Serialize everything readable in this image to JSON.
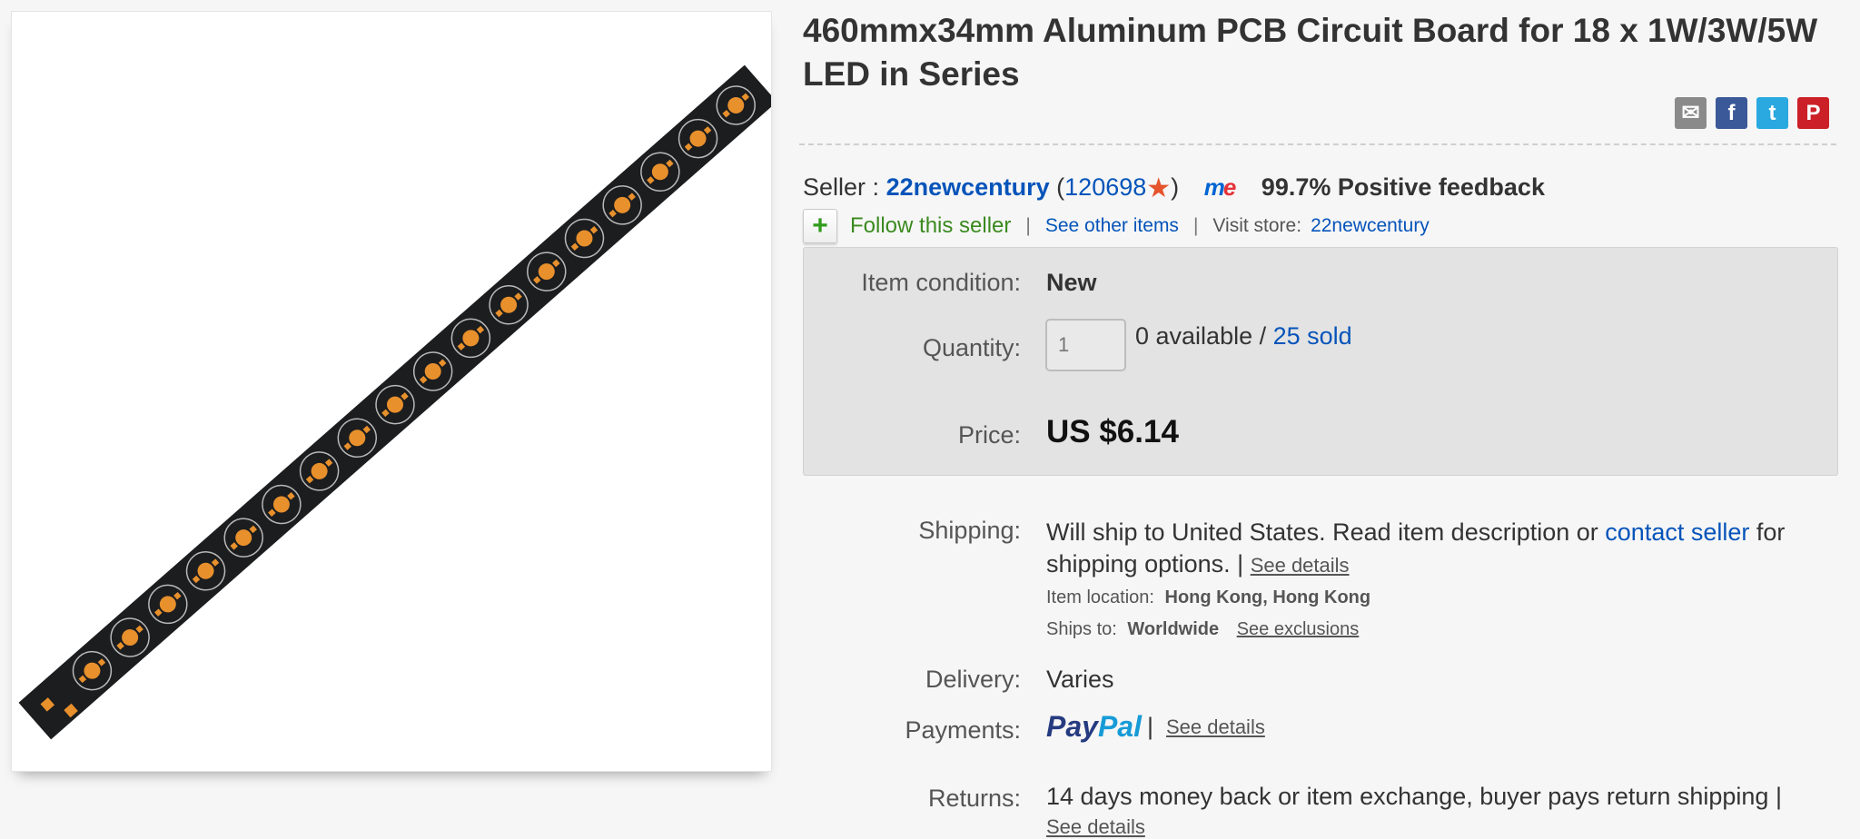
{
  "title": "460mmx34mm Aluminum PCB Circuit Board for 18 x 1W/3W/5W LED in Series",
  "share": {
    "email": "email-icon",
    "facebook": "facebook-icon",
    "twitter": "twitter-icon",
    "pinterest": "pinterest-icon"
  },
  "seller": {
    "label": "Seller :",
    "name": "22newcentury",
    "score": "120698",
    "feedback": "99.7% Positive feedback",
    "follow": "Follow this seller",
    "see_other": "See other items",
    "visit_store_label": "Visit store:",
    "store": "22newcentury"
  },
  "condition": {
    "label": "Item condition:",
    "value": "New",
    "quantity_label": "Quantity:",
    "quantity_value": "1",
    "available": "0 available /",
    "sold": "25 sold",
    "price_label": "Price:",
    "price": "US $6.14"
  },
  "shipping": {
    "label": "Shipping:",
    "text1": "Will ship to United States. Read item description or",
    "contact": "contact seller",
    "text2": "for",
    "text3": "shipping options. |",
    "see_details": "See details",
    "location_label": "Item location:",
    "location": "Hong Kong, Hong Kong",
    "ships_to_label": "Ships to:",
    "ships_to": "Worldwide",
    "see_exclusions": "See exclusions"
  },
  "delivery": {
    "label": "Delivery:",
    "value": "Varies"
  },
  "payments": {
    "label": "Payments:",
    "pay1": "Pay",
    "pay2": "Pal",
    "see_details": "See details"
  },
  "returns": {
    "label": "Returns:",
    "value": "14 days money back or item exchange, buyer pays return shipping |",
    "see_details": "See details"
  },
  "colors": {
    "link": "#0654ba",
    "follow": "#3b8a1e",
    "pcb": "#1c1d1f",
    "pad": "#e8902c"
  }
}
